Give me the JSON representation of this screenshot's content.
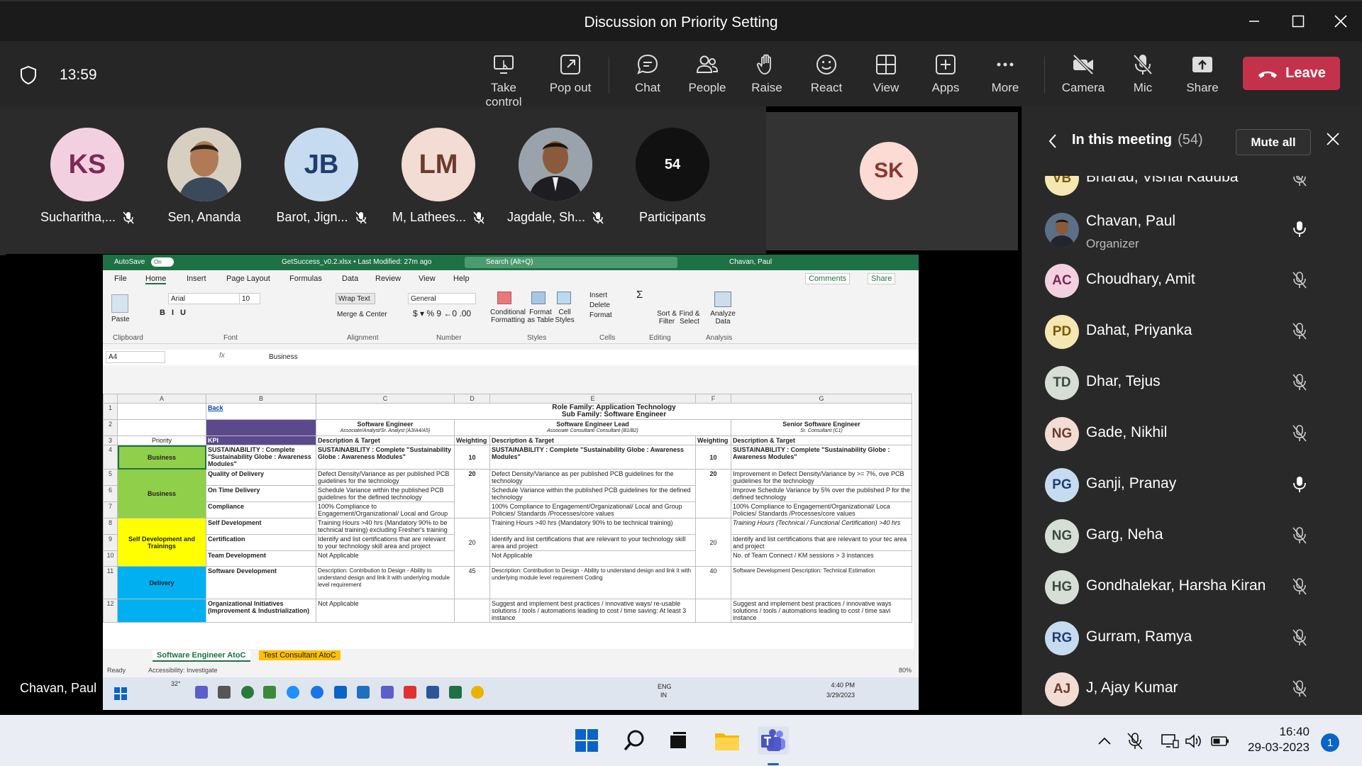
{
  "window": {
    "title": "Discussion on Priority Setting"
  },
  "toolbar": {
    "time": "13:59",
    "buttons": [
      {
        "label": "Take control",
        "icon": "take-control-icon"
      },
      {
        "label": "Pop out",
        "icon": "pop-out-icon"
      },
      {
        "label": "Chat",
        "icon": "chat-icon"
      },
      {
        "label": "People",
        "icon": "people-icon"
      },
      {
        "label": "Raise",
        "icon": "raise-hand-icon"
      },
      {
        "label": "React",
        "icon": "react-icon"
      },
      {
        "label": "View",
        "icon": "view-icon"
      },
      {
        "label": "Apps",
        "icon": "apps-icon"
      },
      {
        "label": "More",
        "icon": "more-icon"
      },
      {
        "label": "Camera",
        "icon": "camera-off-icon"
      },
      {
        "label": "Mic",
        "icon": "mic-off-icon"
      },
      {
        "label": "Share",
        "icon": "share-icon"
      }
    ],
    "leave": "Leave",
    "active_tab": "People"
  },
  "gallery": {
    "tiles": [
      {
        "initials": "KS",
        "name": "Sucharitha,...",
        "muted": true,
        "color": "#f3d0e0",
        "text": "#7c2855"
      },
      {
        "initials": "",
        "name": "Sen, Ananda",
        "muted": false,
        "photo": true
      },
      {
        "initials": "JB",
        "name": "Barot, Jign...",
        "muted": true,
        "color": "#c7dbf0",
        "text": "#1f3e6e"
      },
      {
        "initials": "LM",
        "name": "M, Lathees...",
        "muted": true,
        "color": "#f2dcd3",
        "text": "#6b3b2e"
      },
      {
        "initials": "",
        "name": "Jagdale, Sh...",
        "muted": true,
        "photo": true
      },
      {
        "initials": "54",
        "name": "Participants",
        "muted": false,
        "color": "#111111",
        "text": "#ffffff"
      }
    ],
    "spotlight": {
      "initials": "SK"
    }
  },
  "presenter": "Chavan, Paul",
  "excel": {
    "autosave": "AutoSave",
    "autosave_state": "On",
    "filename": "GetSuccess_v0.2.xlsx • Last Modified: 27m ago",
    "search": "Search (Alt+Q)",
    "user": "Chavan, Paul",
    "tabs": [
      "File",
      "Home",
      "Insert",
      "Page Layout",
      "Formulas",
      "Data",
      "Review",
      "View",
      "Help"
    ],
    "comments": "Comments",
    "share": "Share",
    "ribbon": {
      "font_name": "Arial",
      "font_size": "10",
      "wrap": "Wrap Text",
      "merge": "Merge & Center",
      "number_format": "General",
      "groups": [
        "Clipboard",
        "Font",
        "Alignment",
        "Number",
        "Styles",
        "Cells",
        "Editing",
        "Analysis"
      ],
      "paste": "Paste",
      "cond": "Conditional Formatting",
      "fmt_table": "Format as Table",
      "cell_styles": "Cell Styles",
      "insert": "Insert",
      "delete": "Delete",
      "format": "Format",
      "sort": "Sort & Filter",
      "find": "Find & Select",
      "analyze": "Analyze Data"
    },
    "namebox": "A4",
    "formula": "Business",
    "cols": [
      "A",
      "B",
      "C",
      "D",
      "E",
      "F",
      "G"
    ],
    "sheet": {
      "back": "Back",
      "role_family": "Role Family: Application Technology",
      "sub_family": "Sub Family: Software Engineer",
      "priority": "Priority",
      "kpi": "KPI",
      "se": "Software Engineer",
      "se_sub": "Associate/Analyst/Sr. Analyst (A3/A4/A5)",
      "sel": "Software Engineer Lead",
      "sel_sub": "Associate Consultant/ Consultant (B1/B2)",
      "sse": "Senior Software Engineer",
      "sse_sub": "Sr. Consultant (C1)",
      "desc": "Description & Target",
      "weight": "Weighting",
      "rows": [
        {
          "n": "4",
          "a": "Business",
          "b": "SUSTAINABILITY : Complete \"Sustainability Globe : Awareness Modules\"",
          "c": "SUSTAINABILITY : Complete \"Sustainability Globe : Awareness Modules\"",
          "d": "10",
          "e": "SUSTAINABILITY : Complete \"Sustainability Globe : Awareness Modules\"",
          "f": "10",
          "g": "SUSTAINABILITY : Complete \"Sustainability Globe : Awareness Modules\""
        },
        {
          "n": "5",
          "a": "Business",
          "b": "Quality of Delivery",
          "c": "Defect Density/Variance as per published PCB guidelines for the technology",
          "d": "20",
          "e": "Defect Density/Variance as per published PCB guidelines for the technology",
          "f": "20",
          "g": "Improvement in Defect Density/Variance by >= 7%, ove PCB guidelines for the technology"
        },
        {
          "n": "6",
          "a": "",
          "b": "On Time Delivery",
          "c": "Schedule Variance within the published PCB guidelines for the defined technology",
          "d": "",
          "e": "Schedule Variance within the published PCB guidelines for the defined technology",
          "f": "",
          "g": "Improve Schedule Variance by 5% over the published P for the defined technology"
        },
        {
          "n": "7",
          "a": "",
          "b": "Compliance",
          "c": "100% Compliance to Engagement/Organizational/ Local and Group",
          "d": "",
          "e": "100% Compliance to Engagement/Organizational/ Local and Group Policies/ Standards /Processes/core values",
          "f": "",
          "g": "100% Compliance to Engagement/Organizational/ Loca Policies/ Standards /Processes/core values"
        },
        {
          "n": "8",
          "a": "Self Development and Trainings",
          "b": "Self Development",
          "c": "Training Hours >40 hrs (Mandatory 90% to be technical training) excluding Fresher's training",
          "d": "",
          "e": "Training Hours >40 hrs (Mandatory 90% to be technical training)",
          "f": "",
          "g": "Training Hours (Technical / Functional Certification) >40 hrs"
        },
        {
          "n": "9",
          "a": "",
          "b": "Certification",
          "c": "Identify and list certifications that are relevant to your technology skill area and project",
          "d": "20",
          "e": "Identify and list certifications that are relevant to your technology skill area and project",
          "f": "20",
          "g": "Identify and list certifications that are relevant to your tec area and project"
        },
        {
          "n": "10",
          "a": "",
          "b": "Team Development",
          "c": "Not Applicable",
          "d": "",
          "e": "Not Applicable",
          "f": "",
          "g": "No. of Team Connect / KM sessions > 3 instances"
        },
        {
          "n": "11",
          "a": "Delivery",
          "b": "Software Development",
          "c": "Description: Contribution to Design - Ability to understand design and link it with underlying module level requirement",
          "d": "45",
          "e": "Description: Contribution to Design - Ability to understand design and link it with underlying module level requirement  Coding",
          "f": "40",
          "g": "Software Development  Description: Technical Estimation"
        },
        {
          "n": "12",
          "a": "",
          "b": "Organizational Initiatives (Improvement & Industrialization)",
          "c": "Not Applicable",
          "d": "",
          "e": "Suggest and implement best practices / innovative ways/ re-usable solutions / tools / automations leading to cost / time saving: At least 3 instance",
          "f": "",
          "g": "Suggest and implement best practices / innovative ways solutions / tools / automations leading to cost / time savi instance"
        }
      ]
    },
    "sheet_tabs": [
      "Software Engineer AtoC",
      "Test Consultant AtoC"
    ],
    "status_ready": "Ready",
    "status_access": "Accessibility: Investigate",
    "zoom": "80%",
    "inner_clock": {
      "time": "4:40 PM",
      "date": "3/29/2023",
      "lang": "ENG",
      "region": "IN",
      "weather": "32°"
    }
  },
  "panel": {
    "title": "In this meeting",
    "count": "(54)",
    "mute_all": "Mute all",
    "people": [
      {
        "initials": "VB",
        "name": "Bharad, Vishal Kaduba",
        "role": "",
        "mic": "off",
        "color": "#f6e7b2",
        "text": "#7a5a00",
        "partial": true
      },
      {
        "initials": "",
        "name": "Chavan, Paul",
        "role": "Organizer",
        "mic": "on",
        "photo": true
      },
      {
        "initials": "AC",
        "name": "Choudhary, Amit",
        "role": "",
        "mic": "off",
        "color": "#f3d0e0",
        "text": "#7c2855"
      },
      {
        "initials": "PD",
        "name": "Dahat, Priyanka",
        "role": "",
        "mic": "off",
        "color": "#f6e7b2",
        "text": "#7a5a00"
      },
      {
        "initials": "TD",
        "name": "Dhar, Tejus",
        "role": "",
        "mic": "off",
        "color": "#d6ded6",
        "text": "#3b4a3b"
      },
      {
        "initials": "NG",
        "name": "Gade, Nikhil",
        "role": "",
        "mic": "off",
        "color": "#f2dcd3",
        "text": "#6b3b2e"
      },
      {
        "initials": "PG",
        "name": "Ganji, Pranay",
        "role": "",
        "mic": "on",
        "color": "#c7dbf0",
        "text": "#1f3e6e"
      },
      {
        "initials": "NG",
        "name": "Garg, Neha",
        "role": "",
        "mic": "off",
        "color": "#d6ded6",
        "text": "#3b4a3b"
      },
      {
        "initials": "HG",
        "name": "Gondhalekar, Harsha Kiran",
        "role": "",
        "mic": "off",
        "color": "#d6ded6",
        "text": "#3b4a3b"
      },
      {
        "initials": "RG",
        "name": "Gurram, Ramya",
        "role": "",
        "mic": "off",
        "color": "#c7dbf0",
        "text": "#1f3e6e"
      },
      {
        "initials": "AJ",
        "name": "J, Ajay Kumar",
        "role": "",
        "mic": "off",
        "color": "#f2dcd3",
        "text": "#6b3b2e"
      }
    ]
  },
  "taskbar": {
    "time": "16:40",
    "date": "29-03-2023",
    "notifications": "1"
  }
}
